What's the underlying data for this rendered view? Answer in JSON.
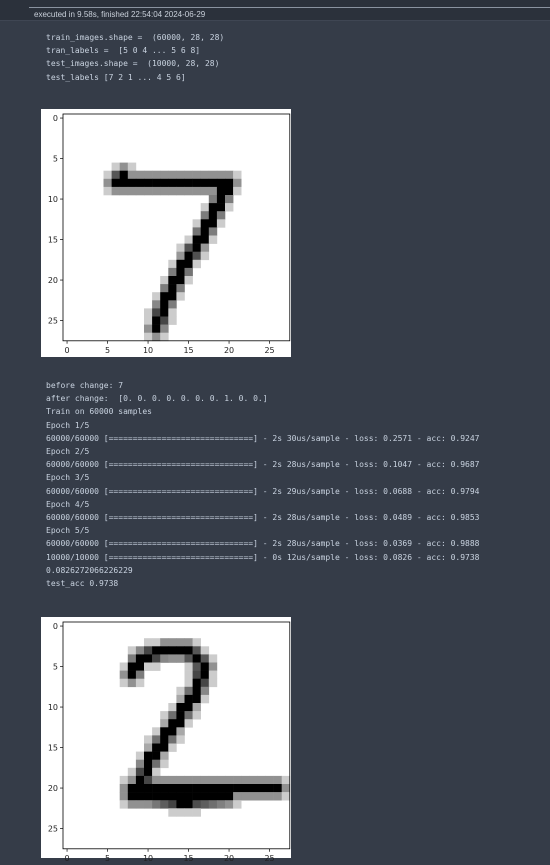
{
  "header": {
    "exec_info": "executed in 9.58s, finished 22:54:04 2024-06-29"
  },
  "output1": {
    "lines": [
      "train_images.shape =  (60000, 28, 28)",
      "tran_labels =  [5 0 4 ... 5 6 8]",
      "test_images.shape =  (10000, 28, 28)",
      "test_labels [7 2 1 ... 4 5 6]"
    ]
  },
  "figure1": {
    "x_ticks": [
      "0",
      "5",
      "10",
      "15",
      "20",
      "25"
    ],
    "y_ticks": [
      "0",
      "5",
      "10",
      "15",
      "20",
      "25"
    ],
    "image": {
      "rows": 28,
      "cols": 28,
      "digit": "7",
      "strokes": [
        [
          [
            6,
            8
          ],
          [
            20,
            8
          ]
        ],
        [
          [
            20,
            8
          ],
          [
            17,
            14
          ],
          [
            14,
            19
          ],
          [
            12,
            23
          ],
          [
            11,
            26
          ]
        ],
        [
          [
            6,
            8
          ],
          [
            7,
            7
          ]
        ]
      ]
    }
  },
  "output2": {
    "lines": [
      "before change: 7",
      "after change:  [0. 0. 0. 0. 0. 0. 0. 1. 0. 0.]",
      "Train on 60000 samples",
      "Epoch 1/5",
      "60000/60000 [==============================] - 2s 30us/sample - loss: 0.2571 - acc: 0.9247",
      "Epoch 2/5",
      "60000/60000 [==============================] - 2s 28us/sample - loss: 0.1047 - acc: 0.9687",
      "Epoch 3/5",
      "60000/60000 [==============================] - 2s 29us/sample - loss: 0.0688 - acc: 0.9794",
      "Epoch 4/5",
      "60000/60000 [==============================] - 2s 28us/sample - loss: 0.0489 - acc: 0.9853",
      "Epoch 5/5",
      "60000/60000 [==============================] - 2s 28us/sample - loss: 0.0369 - acc: 0.9888",
      "10000/10000 [==============================] - 0s 12us/sample - loss: 0.0826 - acc: 0.9738",
      "0.0826272066226229",
      "test_acc 0.9738"
    ]
  },
  "figure2": {
    "x_ticks": [
      "0",
      "5",
      "10",
      "15",
      "20",
      "25"
    ],
    "y_ticks": [
      "0",
      "5",
      "10",
      "15",
      "20",
      "25"
    ],
    "image": {
      "rows": 28,
      "cols": 28,
      "digit": "2",
      "strokes": [
        [
          [
            8,
            6
          ],
          [
            9,
            4
          ],
          [
            12,
            3
          ],
          [
            15,
            3
          ],
          [
            17,
            5
          ],
          [
            16,
            8
          ],
          [
            14,
            11
          ],
          [
            12,
            14
          ],
          [
            10,
            17
          ],
          [
            9,
            20
          ]
        ],
        [
          [
            8,
            20
          ],
          [
            10,
            20
          ],
          [
            14,
            20
          ],
          [
            18,
            20
          ],
          [
            22,
            20
          ],
          [
            26,
            20
          ]
        ],
        [
          [
            8,
            21
          ],
          [
            10,
            21
          ],
          [
            14,
            21.5
          ],
          [
            20,
            21
          ]
        ]
      ]
    }
  }
}
